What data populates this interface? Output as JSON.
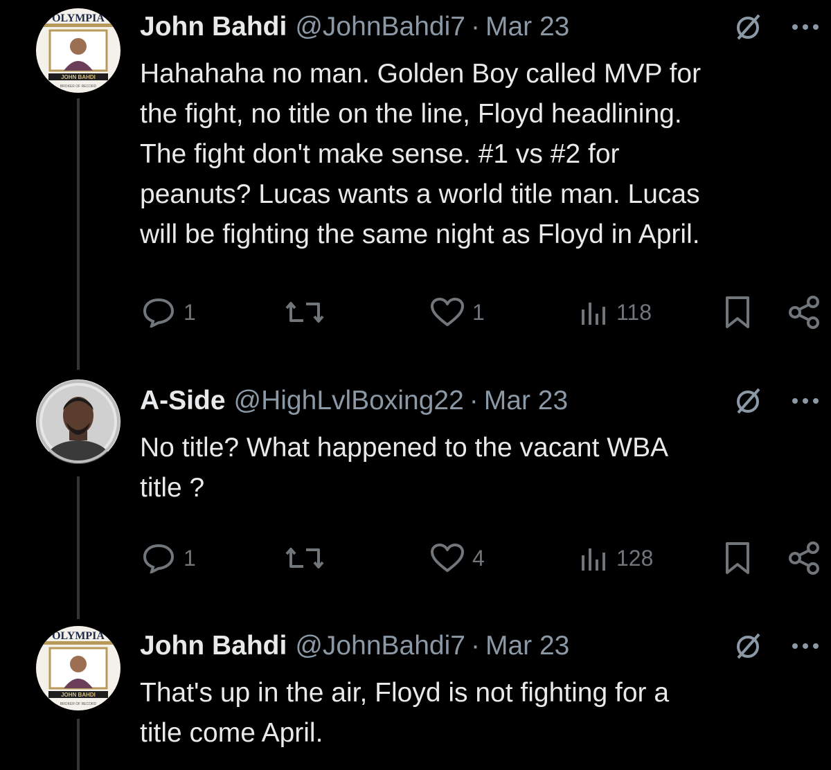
{
  "tweets": [
    {
      "display_name": "John Bahdi",
      "handle": "@JohnBahdi7",
      "separator": "·",
      "date": "Mar 23",
      "avatar_text_top": "OLYMPIA",
      "avatar_text_bottom": "JOHN BAHDI",
      "avatar_text_sub": "BROKER OF RECORD",
      "text": "Hahahaha no man. Golden Boy called MVP for\nthe fight, no title on the line, Floyd headlining.\nThe fight don't make sense. #1 vs #2 for\npeanuts? Lucas wants a world title man. Lucas\nwill be fighting the same night as Floyd in April.",
      "replies": "1",
      "retweets": "",
      "likes": "1",
      "views": "118"
    },
    {
      "display_name": "A-Side",
      "handle": "@HighLvlBoxing22",
      "separator": "·",
      "date": "Mar 23",
      "text": "No title? What happened to the vacant WBA\ntitle ?",
      "replies": "1",
      "retweets": "",
      "likes": "4",
      "views": "128"
    },
    {
      "display_name": "John Bahdi",
      "handle": "@JohnBahdi7",
      "separator": "·",
      "date": "Mar 23",
      "avatar_text_top": "OLYMPIA",
      "avatar_text_bottom": "JOHN BAHDI",
      "avatar_text_sub": "BROKER OF RECORD",
      "text": "That's up in the air, Floyd is not fighting for a\ntitle come April."
    }
  ],
  "icons": [
    "reply-icon",
    "retweet-icon",
    "like-icon",
    "views-icon",
    "bookmark-icon",
    "share-icon",
    "grok-icon",
    "more-icon"
  ],
  "colors": {
    "background": "#000000",
    "text": "#e7e9ea",
    "muted": "#71767b",
    "thread_line": "#333639"
  }
}
